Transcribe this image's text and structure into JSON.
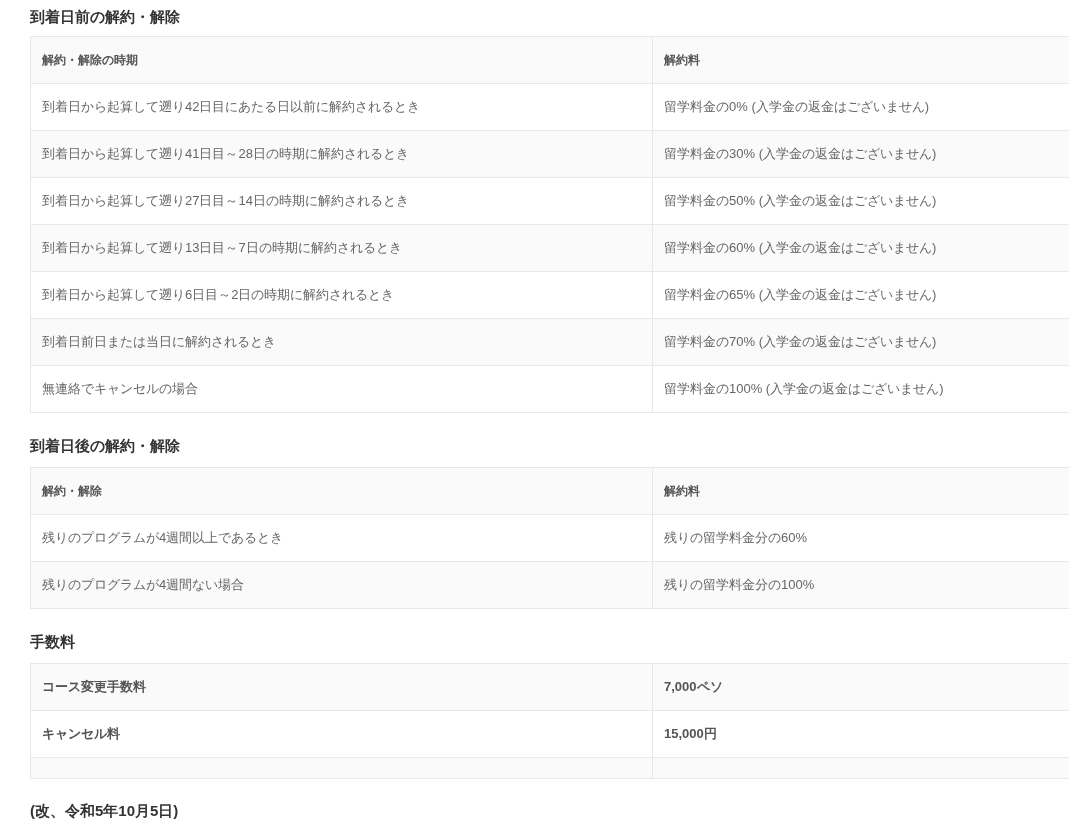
{
  "sections": [
    {
      "heading": "到着日前の解約・解除",
      "table": {
        "columns": [
          "解約・解除の時期",
          "解約料"
        ],
        "rows": [
          {
            "kind": "text",
            "cells": [
              "到着日から起算して遡り42日目にあたる日以前に解約されるとき",
              "留学料金の0% (入学金の返金はございません)"
            ]
          },
          {
            "kind": "text",
            "cells": [
              "到着日から起算して遡り41日目～28日の時期に解約されるとき",
              "留学料金の30% (入学金の返金はございません)"
            ]
          },
          {
            "kind": "text",
            "cells": [
              "到着日から起算して遡り27日目～14日の時期に解約されるとき",
              "留学料金の50% (入学金の返金はございません)"
            ]
          },
          {
            "kind": "text",
            "cells": [
              "到着日から起算して遡り13日目～7日の時期に解約されるとき",
              "留学料金の60% (入学金の返金はございません)"
            ]
          },
          {
            "kind": "text",
            "cells": [
              "到着日から起算して遡り6日目～2日の時期に解約されるとき",
              "留学料金の65% (入学金の返金はございません)"
            ]
          },
          {
            "kind": "text",
            "cells": [
              "到着日前日または当日に解約されるとき",
              "留学料金の70% (入学金の返金はございません)"
            ]
          },
          {
            "kind": "text",
            "cells": [
              "無連絡でキャンセルの場合",
              "留学料金の100% (入学金の返金はございません)"
            ]
          }
        ]
      }
    },
    {
      "heading": "到着日後の解約・解除",
      "table": {
        "columns": [
          "解約・解除",
          "解約料"
        ],
        "rows": [
          {
            "kind": "text",
            "cells": [
              "残りのプログラムが4週間以上であるとき",
              "残りの留学料金分の60%"
            ]
          },
          {
            "kind": "text",
            "cells": [
              "残りのプログラムが4週間ない場合",
              "残りの留学料金分の100%"
            ]
          }
        ]
      }
    },
    {
      "heading": "手数料",
      "table": {
        "rows": [
          {
            "kind": "bold",
            "cells": [
              "コース変更手数料",
              "7,000ペソ"
            ]
          },
          {
            "kind": "bold",
            "cells": [
              "キャンセル料",
              "15,000円"
            ]
          },
          {
            "kind": "blank"
          }
        ]
      }
    }
  ],
  "footer": "(改、令和5年10月5日)"
}
